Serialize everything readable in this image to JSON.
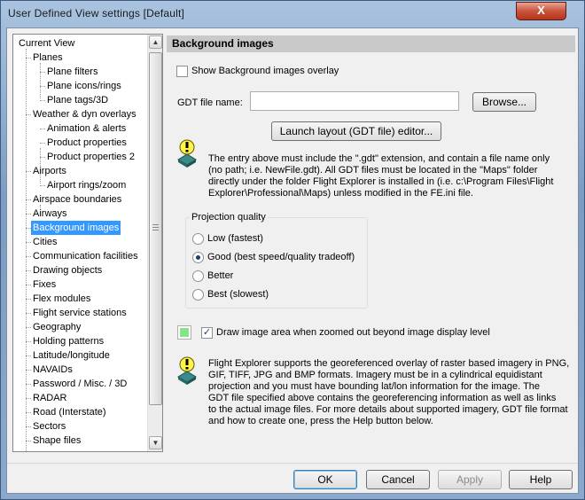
{
  "window": {
    "title": "User Defined View settings  [Default]",
    "close_glyph": "X"
  },
  "tree": {
    "items": [
      {
        "label": "Current View",
        "level": 0
      },
      {
        "label": "Planes",
        "level": 1
      },
      {
        "label": "Plane filters",
        "level": 2
      },
      {
        "label": "Plane icons/rings",
        "level": 2
      },
      {
        "label": "Plane tags/3D",
        "level": 2
      },
      {
        "label": "Weather & dyn overlays",
        "level": 1
      },
      {
        "label": "Animation & alerts",
        "level": 2
      },
      {
        "label": "Product properties",
        "level": 2
      },
      {
        "label": "Product properties 2",
        "level": 2
      },
      {
        "label": "Airports",
        "level": 1
      },
      {
        "label": "Airport rings/zoom",
        "level": 2
      },
      {
        "label": "Airspace boundaries",
        "level": 1
      },
      {
        "label": "Airways",
        "level": 1
      },
      {
        "label": "Background images",
        "level": 1,
        "selected": true
      },
      {
        "label": "Cities",
        "level": 1
      },
      {
        "label": "Communication facilities",
        "level": 1
      },
      {
        "label": "Drawing objects",
        "level": 1
      },
      {
        "label": "Fixes",
        "level": 1
      },
      {
        "label": "Flex modules",
        "level": 1
      },
      {
        "label": "Flight service stations",
        "level": 1
      },
      {
        "label": "Geography",
        "level": 1
      },
      {
        "label": "Holding patterns",
        "level": 1
      },
      {
        "label": "Latitude/longitude",
        "level": 1
      },
      {
        "label": "NAVAIDs",
        "level": 1
      },
      {
        "label": "Password / Misc. / 3D",
        "level": 1
      },
      {
        "label": "RADAR",
        "level": 1
      },
      {
        "label": "Road (Interstate)",
        "level": 1
      },
      {
        "label": "Sectors",
        "level": 1
      },
      {
        "label": "Shape files",
        "level": 1
      }
    ],
    "scroll_up": "▲",
    "scroll_down": "▼"
  },
  "panel": {
    "header": "Background images",
    "show_overlay_label": "Show Background images overlay",
    "show_overlay_checked": false,
    "gdt_label": "GDT file name:",
    "gdt_value": "",
    "browse_label": "Browse...",
    "launch_label": "Launch layout (GDT file) editor...",
    "note1_lines": [
      "The entry above must include the \".gdt\" extension, and contain a file name only",
      "(no path; i.e. NewFile.gdt).  All GDT files must be located in the \"Maps\" folder",
      "directly under the folder Flight Explorer is installed in (i.e. c:\\Program Files\\Flight",
      "Explorer\\Professional\\Maps) unless modified in the FE.ini file."
    ],
    "projection": {
      "title": "Projection quality",
      "options": [
        {
          "label": "Low (fastest)",
          "checked": false
        },
        {
          "label": "Good (best speed/quality tradeoff)",
          "checked": true
        },
        {
          "label": "Better",
          "checked": false
        },
        {
          "label": "Best (slowest)",
          "checked": false
        }
      ]
    },
    "swatch_color": "#88e488",
    "draw_area_label": "Draw image area when zoomed out beyond image display level",
    "draw_area_checked": true,
    "note2_lines": [
      "Flight Explorer supports the georeferenced overlay of raster based imagery in PNG,",
      "GIF, TIFF, JPG and BMP formats.  Imagery must be in a cylindrical equidistant",
      "projection and you must have bounding lat/lon information for the image.  The",
      "GDT file specified above contains the georeferencing information as well as links",
      "to the actual image files.  For more details about supported imagery, GDT file format",
      "and how to create one, press the Help button below."
    ]
  },
  "buttons": {
    "ok": "OK",
    "cancel": "Cancel",
    "apply": "Apply",
    "help": "Help"
  }
}
